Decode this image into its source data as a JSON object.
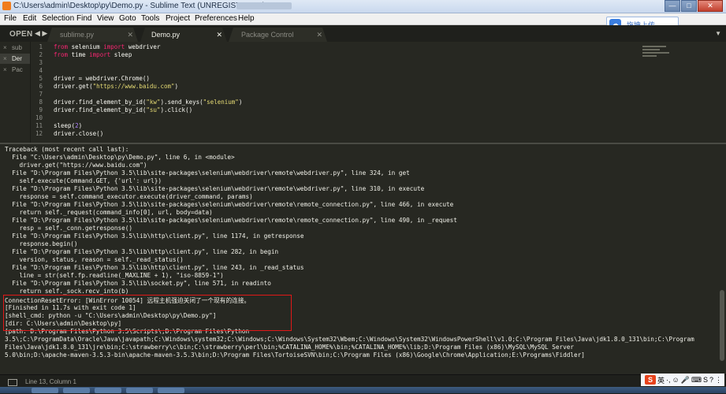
{
  "window": {
    "title": "C:\\Users\\admin\\Desktop\\py\\Demo.py - Sublime Text (UNREGISTERED)",
    "controls": [
      "—",
      "□",
      "✕"
    ]
  },
  "menu": {
    "items": [
      "File",
      "Edit",
      "Selection",
      "Find",
      "View",
      "Goto",
      "Tools",
      "Project",
      "Preferences",
      "Help"
    ],
    "cloud_button": "拖拽上传",
    "cloud_icon": "cloud-icon"
  },
  "tabs": {
    "open_label": "OPEN",
    "nav_arrows": "◀ ▶",
    "items": [
      {
        "label": "sublime.py",
        "close": "✕"
      },
      {
        "label": "Demo.py",
        "close": "✕"
      },
      {
        "label": "Package Control Messages",
        "close": "✕"
      }
    ],
    "dropdown": "▼"
  },
  "sidebar": {
    "files": [
      {
        "close": "×",
        "label": "sub"
      },
      {
        "close": "×",
        "label": "Der"
      },
      {
        "close": "×",
        "label": "Pac"
      }
    ]
  },
  "code": {
    "line_numbers": [
      "1",
      "2",
      "3",
      "4",
      "5",
      "6",
      "7",
      "8",
      "9",
      "10",
      "11",
      "12"
    ],
    "lines": [
      [
        "from",
        " selenium ",
        "import",
        " webdriver"
      ],
      [
        "from",
        " time ",
        "import",
        " sleep"
      ],
      [],
      [],
      [
        "driver = webdriver.Chrome()"
      ],
      [
        "driver.get(",
        "\"https://www.baidu.com\"",
        ")"
      ],
      [],
      [
        "driver.find_element_by_id(",
        "\"kw\"",
        ").send_keys(",
        "\"selenium\"",
        ")"
      ],
      [
        "driver.find_element_by_id(",
        "\"su\"",
        ").click()"
      ],
      [],
      [
        "sleep(",
        "2",
        ")"
      ],
      [
        "driver.close()"
      ]
    ]
  },
  "console": {
    "lines": [
      "Traceback (most recent call last):",
      "  File \"C:\\Users\\admin\\Desktop\\py\\Demo.py\", line 6, in <module>",
      "    driver.get(\"https://www.baidu.com\")",
      "  File \"D:\\Program Files\\Python 3.5\\lib\\site-packages\\selenium\\webdriver\\remote\\webdriver.py\", line 324, in get",
      "    self.execute(Command.GET, {'url': url})",
      "  File \"D:\\Program Files\\Python 3.5\\lib\\site-packages\\selenium\\webdriver\\remote\\webdriver.py\", line 310, in execute",
      "    response = self.command_executor.execute(driver_command, params)",
      "  File \"D:\\Program Files\\Python 3.5\\lib\\site-packages\\selenium\\webdriver\\remote\\remote_connection.py\", line 466, in execute",
      "    return self._request(command_info[0], url, body=data)",
      "  File \"D:\\Program Files\\Python 3.5\\lib\\site-packages\\selenium\\webdriver\\remote\\remote_connection.py\", line 490, in _request",
      "    resp = self._conn.getresponse()",
      "  File \"D:\\Program Files\\Python 3.5\\lib\\http\\client.py\", line 1174, in getresponse",
      "    response.begin()",
      "  File \"D:\\Program Files\\Python 3.5\\lib\\http\\client.py\", line 282, in begin",
      "    version, status, reason = self._read_status()",
      "  File \"D:\\Program Files\\Python 3.5\\lib\\http\\client.py\", line 243, in _read_status",
      "    line = str(self.fp.readline(_MAXLINE + 1), \"iso-8859-1\")",
      "  File \"D:\\Program Files\\Python 3.5\\lib\\socket.py\", line 571, in readinto",
      "    return self._sock.recv_into(b)",
      "ConnectionResetError: [WinError 10054] 远程主机强迫关闭了一个现有的连接。",
      "[Finished in 11.7s with exit code 1]",
      "[shell_cmd: python -u \"C:\\Users\\admin\\Desktop\\py\\Demo.py\"]",
      "[dir: C:\\Users\\admin\\Desktop\\py]",
      "[path: D:\\Program Files\\Python 3.5\\Scripts\\;D:\\Program Files\\Python",
      "3.5\\;C:\\ProgramData\\Oracle\\Java\\javapath;C:\\Windows\\system32;C:\\Windows;C:\\Windows\\System32\\Wbem;C:\\Windows\\System32\\WindowsPowerShell\\v1.0;C:\\Program Files\\Java\\jdk1.8.0_131\\bin;C:\\Program",
      "Files\\Java\\jdk1.8.0_131\\jre\\bin;C:\\strawberry\\c\\bin;C:\\strawberry\\perl\\bin;%CATALINA_HOME%\\bin;%CATALINA_HOME%\\lib;D:\\Program Files (x86)\\MySQL\\MySQL Server",
      "5.0\\bin;D:\\apache-maven-3.5.3-bin\\apache-maven-3.5.3\\bin;D:\\Program Files\\TortoiseSVN\\bin;C:\\Program Files (x86)\\Google\\Chrome\\Application;E:\\Programs\\Fiddler]"
    ]
  },
  "status": {
    "text": "Line 13, Column 1",
    "tray": [
      "S",
      "英",
      "·,",
      "☺",
      "🎤",
      "⌨",
      "S",
      "?",
      "⋮"
    ]
  }
}
